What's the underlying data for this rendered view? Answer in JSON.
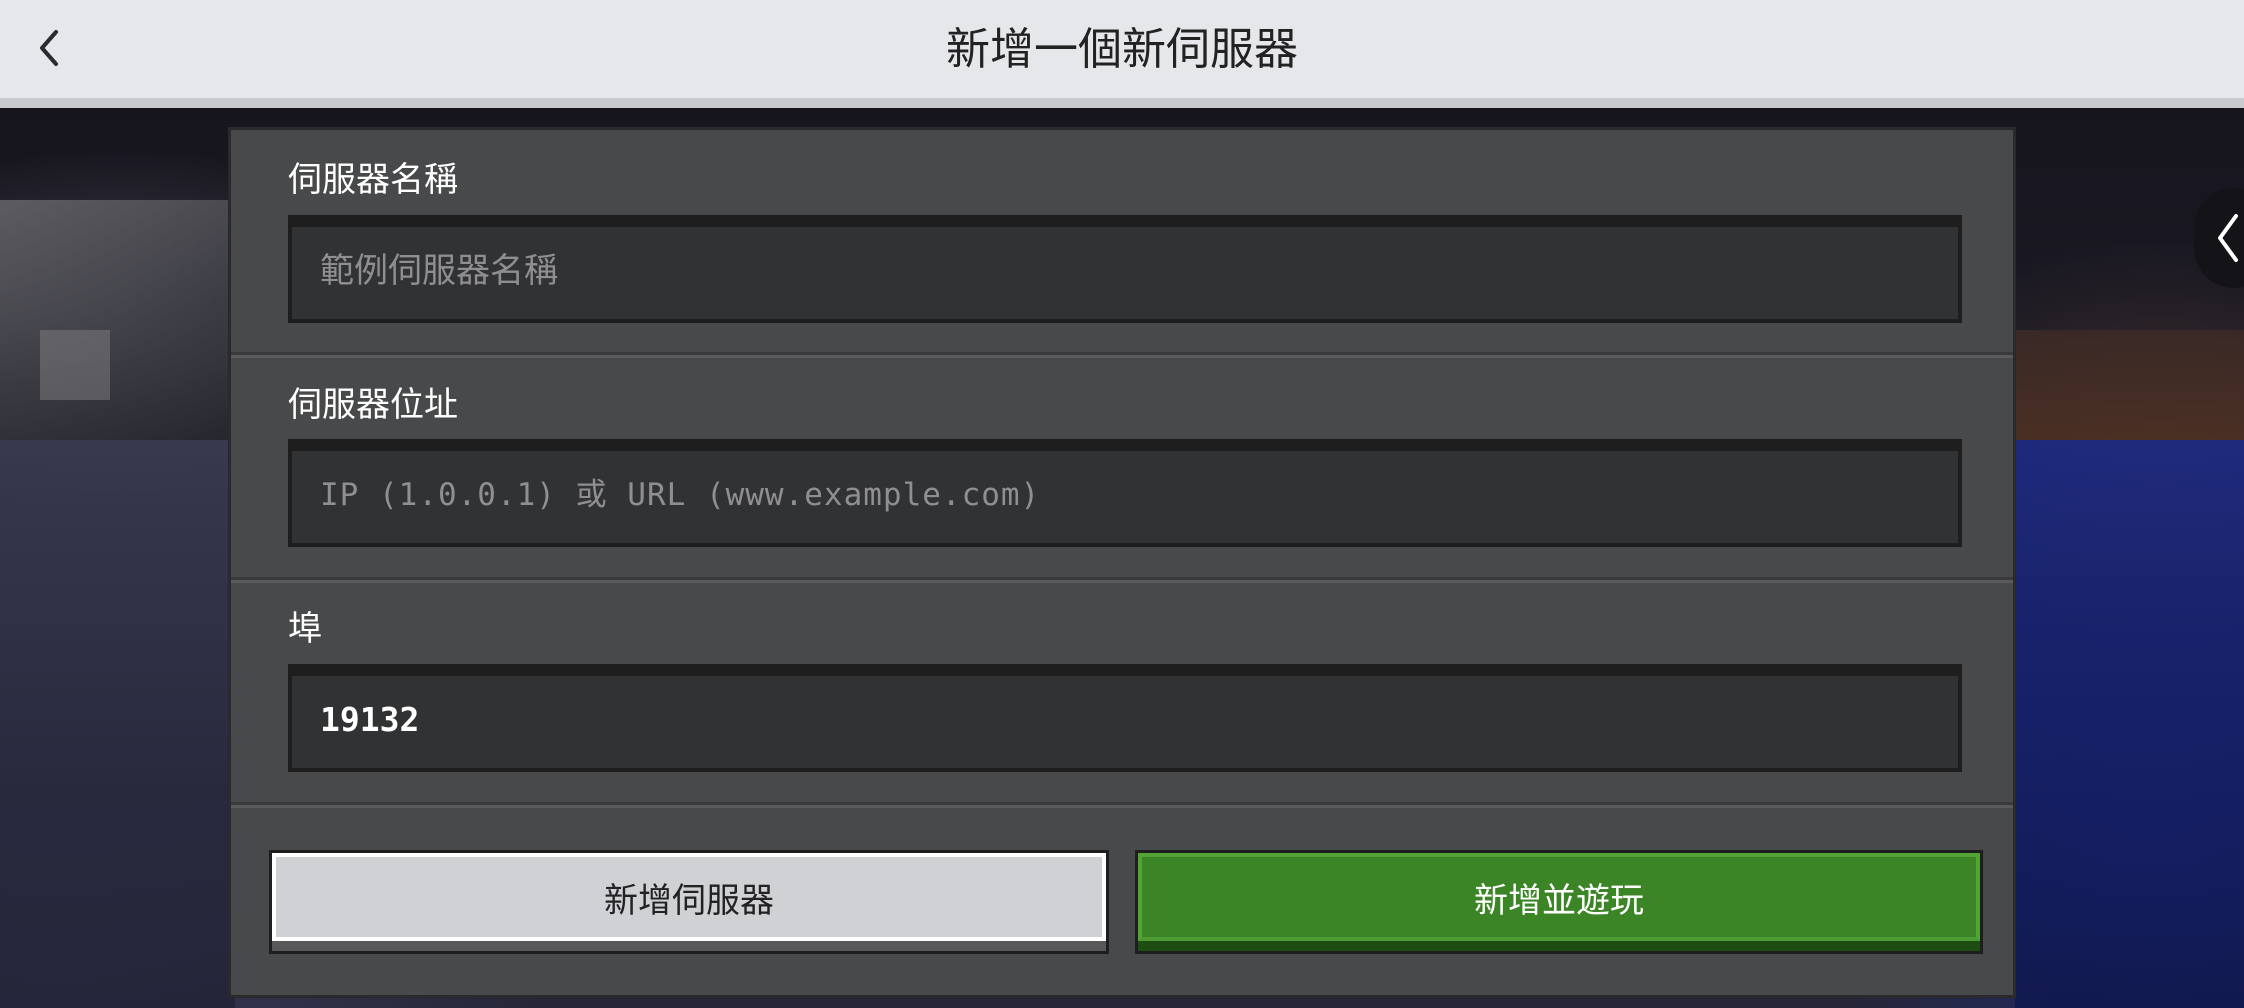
{
  "header": {
    "title": "新增一個新伺服器",
    "back_icon": "chevron-left-icon"
  },
  "side_tab": {
    "icon": "chevron-left-icon"
  },
  "form": {
    "server_name": {
      "label": "伺服器名稱",
      "placeholder": "範例伺服器名稱",
      "value": ""
    },
    "server_address": {
      "label": "伺服器位址",
      "placeholder": "IP (1.0.0.1) 或 URL (www.example.com)",
      "value": ""
    },
    "port": {
      "label": "埠",
      "value": "19132"
    }
  },
  "buttons": {
    "add_server": "新增伺服器",
    "add_and_play": "新增並遊玩"
  },
  "colors": {
    "header_bg": "#e6e7ea",
    "panel_bg": "#48494a",
    "input_bg": "#313233",
    "primary_green": "#3c8527",
    "secondary_gray": "#d0d1d4"
  }
}
